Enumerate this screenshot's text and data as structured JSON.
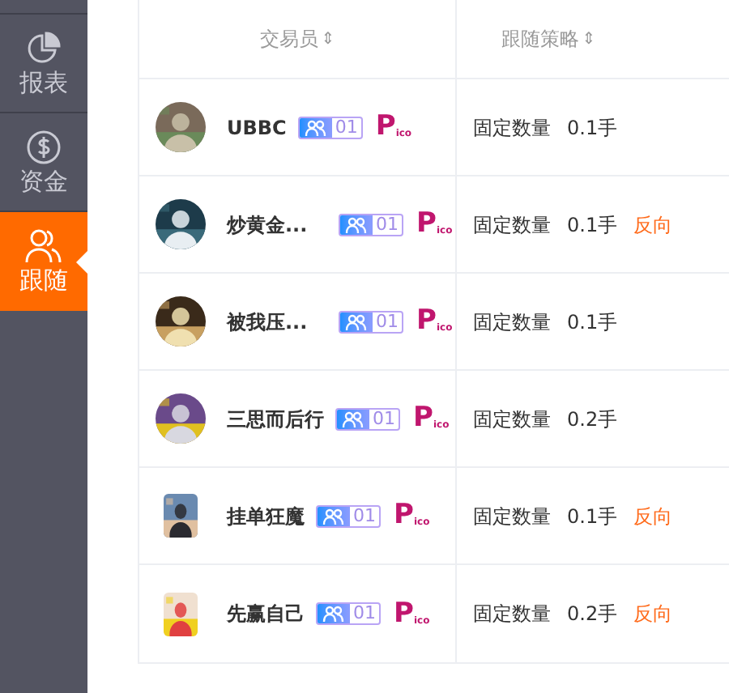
{
  "sidebar": {
    "items": [
      {
        "label": "报表",
        "selected": false
      },
      {
        "label": "资金",
        "selected": false
      },
      {
        "label": "跟随",
        "selected": true
      }
    ]
  },
  "table": {
    "columns": [
      {
        "label": "交易员",
        "sort": "⇕"
      },
      {
        "label": "跟随策略",
        "sort": "⇕"
      }
    ],
    "rows": [
      {
        "avatar": {
          "kind": "round"
        },
        "name": "UBBC",
        "badge": "01",
        "logo": {
          "main": "P",
          "sub": "ico"
        },
        "mode": "固定数量",
        "amount": "0.1手"
      },
      {
        "avatar": {
          "kind": "round"
        },
        "name": "炒黄金...",
        "badge": "01",
        "logo": {
          "main": "P",
          "sub": "ico"
        },
        "mode": "固定数量",
        "amount": "0.1手",
        "direction": "反向"
      },
      {
        "avatar": {
          "kind": "round"
        },
        "name": "被我压...",
        "badge": "01",
        "logo": {
          "main": "P",
          "sub": "ico"
        },
        "mode": "固定数量",
        "amount": "0.1手"
      },
      {
        "avatar": {
          "kind": "round"
        },
        "name": "三思而后行",
        "badge": "01",
        "logo": {
          "main": "P",
          "sub": "ico"
        },
        "mode": "固定数量",
        "amount": "0.2手"
      },
      {
        "avatar": {
          "kind": "square"
        },
        "name": "挂单狂魔",
        "badge": "01",
        "logo": {
          "main": "P",
          "sub": "ico"
        },
        "mode": "固定数量",
        "amount": "0.1手",
        "direction": "反向"
      },
      {
        "avatar": {
          "kind": "square"
        },
        "name": "先赢自己",
        "badge": "01",
        "logo": {
          "main": "P",
          "sub": "ico"
        },
        "mode": "固定数量",
        "amount": "0.2手",
        "direction": "反向"
      }
    ]
  }
}
